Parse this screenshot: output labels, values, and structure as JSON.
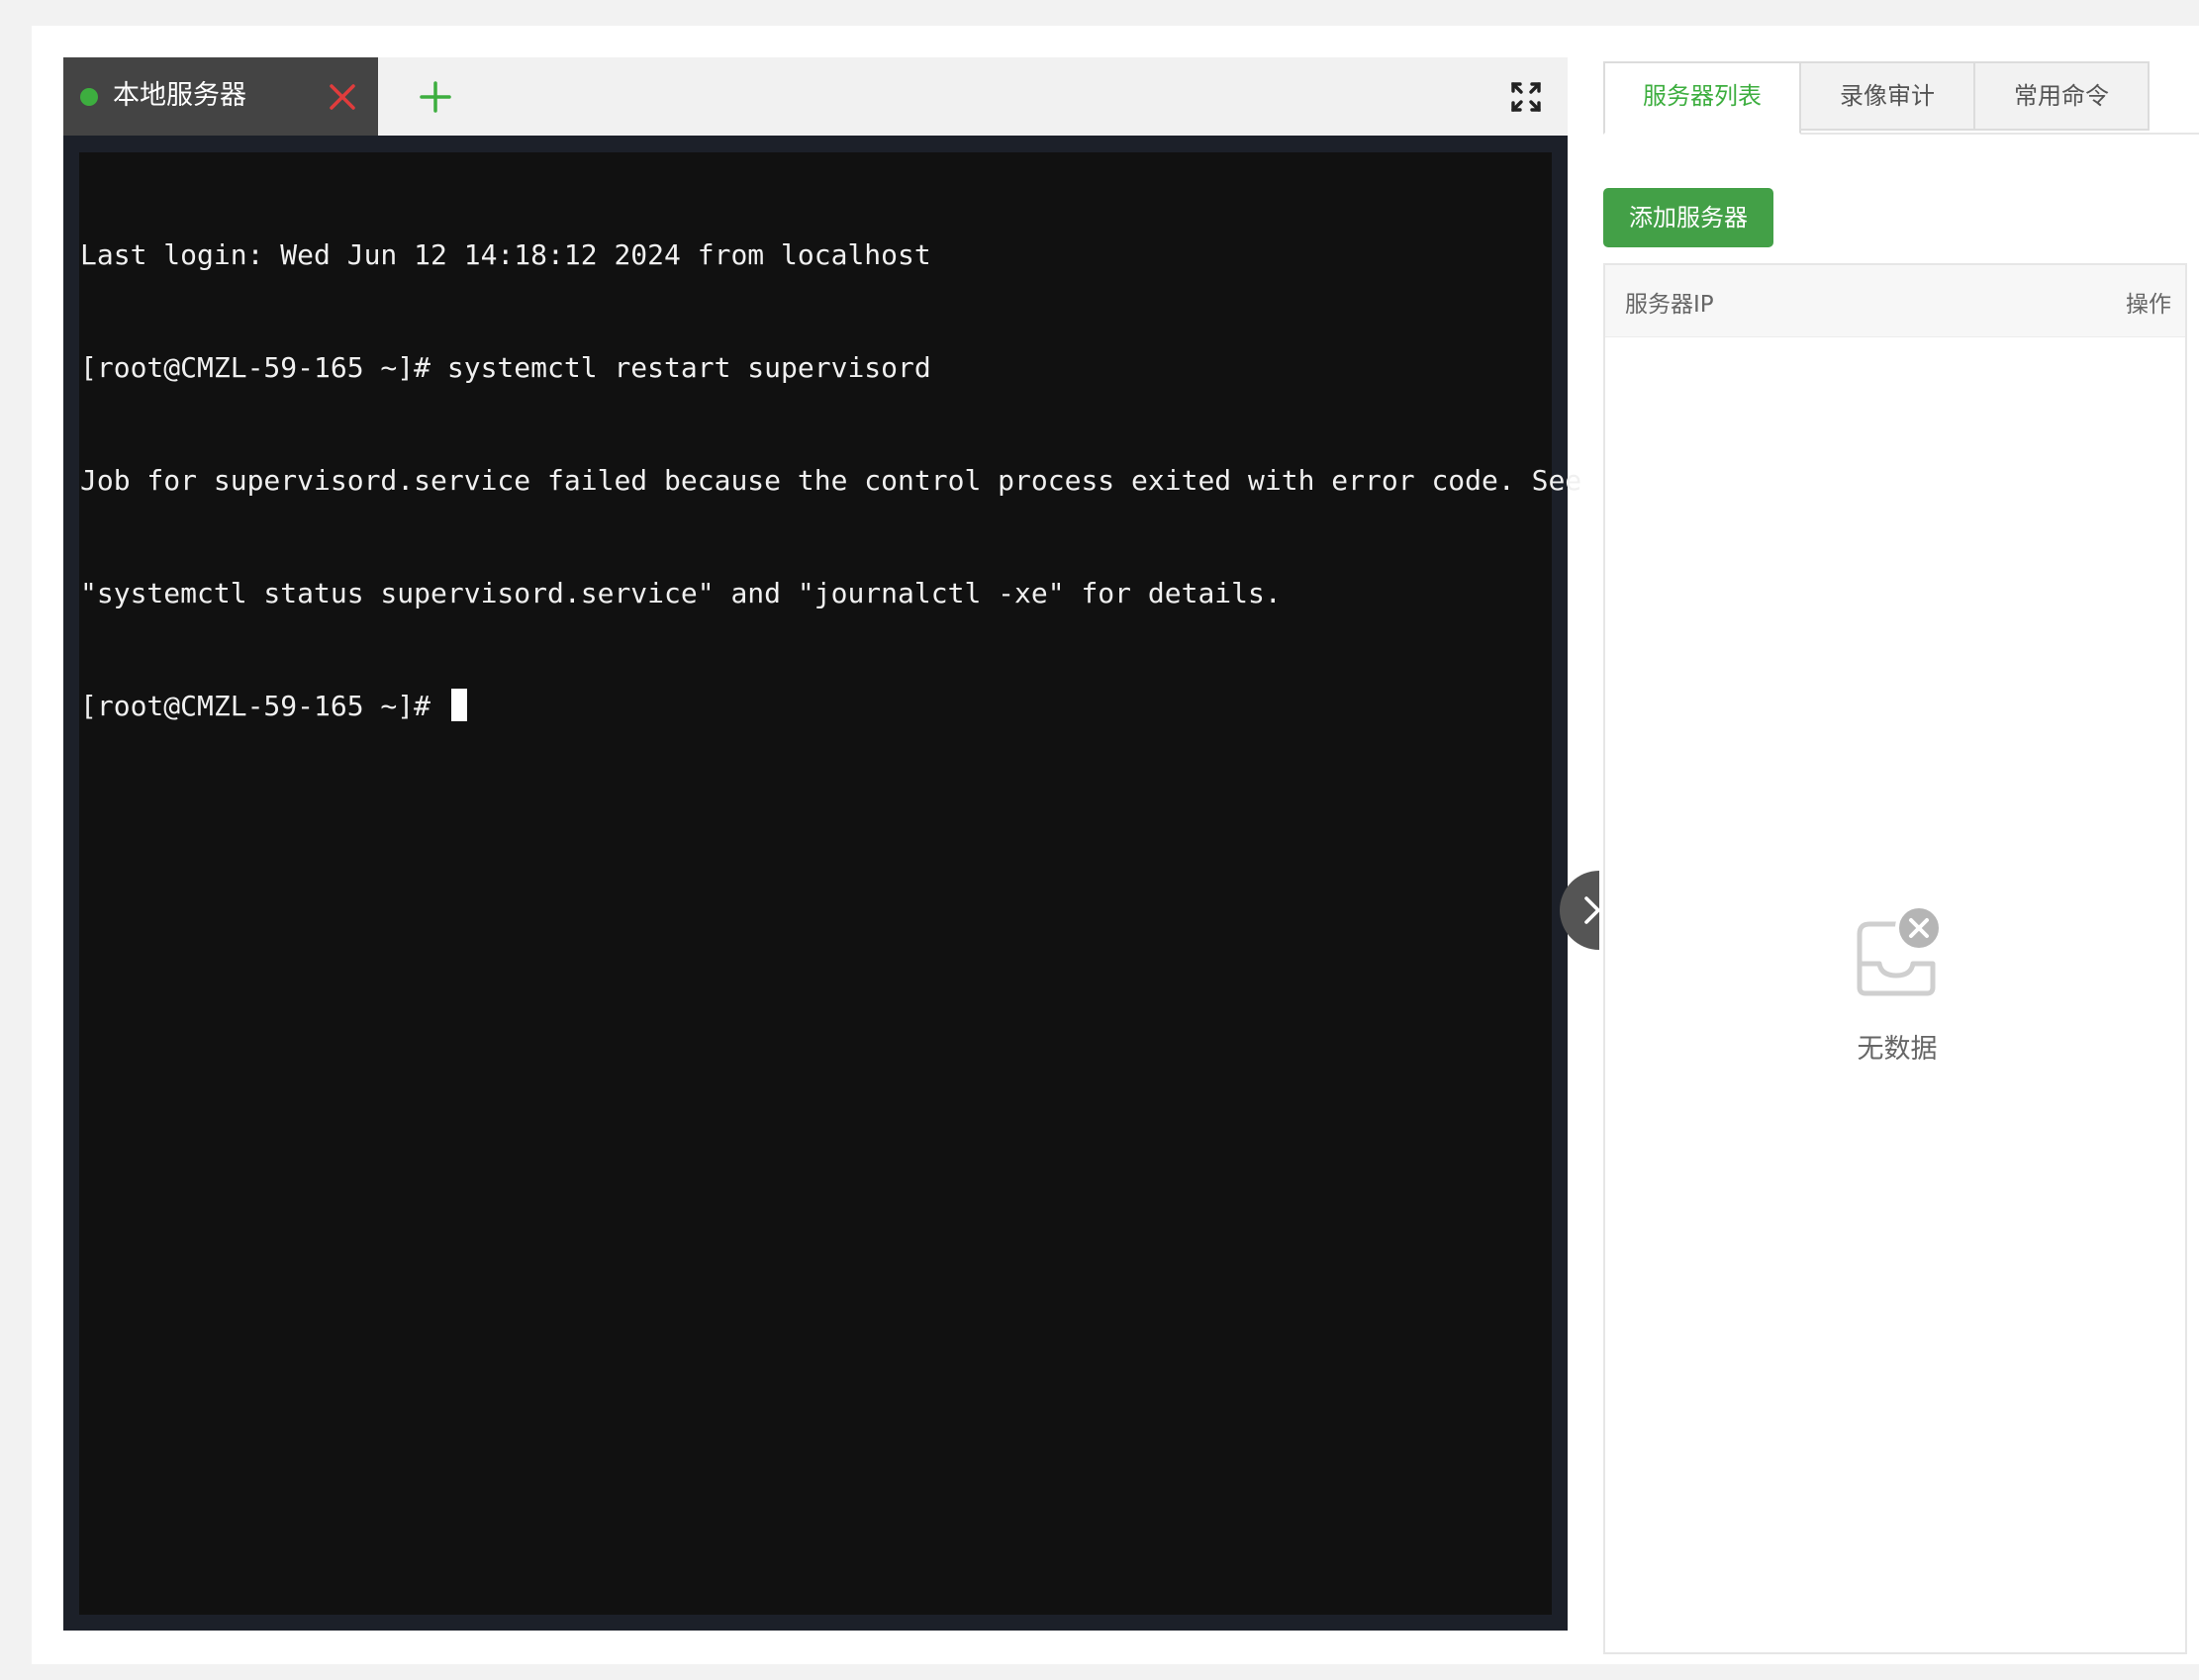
{
  "terminal_tabs": [
    {
      "label": "本地服务器",
      "status": "connected",
      "status_color": "#3dae3f"
    }
  ],
  "icons": {
    "close": "close-icon",
    "add": "plus-icon",
    "fullscreen": "fullscreen-icon",
    "collapse": "chevron-right-icon",
    "empty": "empty-inbox-icon"
  },
  "terminal": {
    "lines": [
      "Last login: Wed Jun 12 14:18:12 2024 from localhost",
      "[root@CMZL-59-165 ~]# systemctl restart supervisord",
      "Job for supervisord.service failed because the control process exited with error code. See",
      "\"systemctl status supervisord.service\" and \"journalctl -xe\" for details."
    ],
    "prompt": "[root@CMZL-59-165 ~]# "
  },
  "sidebar": {
    "tabs": [
      {
        "label": "服务器列表",
        "active": true
      },
      {
        "label": "录像审计",
        "active": false
      },
      {
        "label": "常用命令",
        "active": false
      }
    ],
    "add_button_label": "添加服务器",
    "table": {
      "columns": [
        "服务器IP",
        "操作"
      ],
      "empty_text": "无数据"
    }
  },
  "colors": {
    "accent": "#3dae3f",
    "button": "#43a047",
    "close": "#e03c3c",
    "terminal_bg": "#111111"
  }
}
